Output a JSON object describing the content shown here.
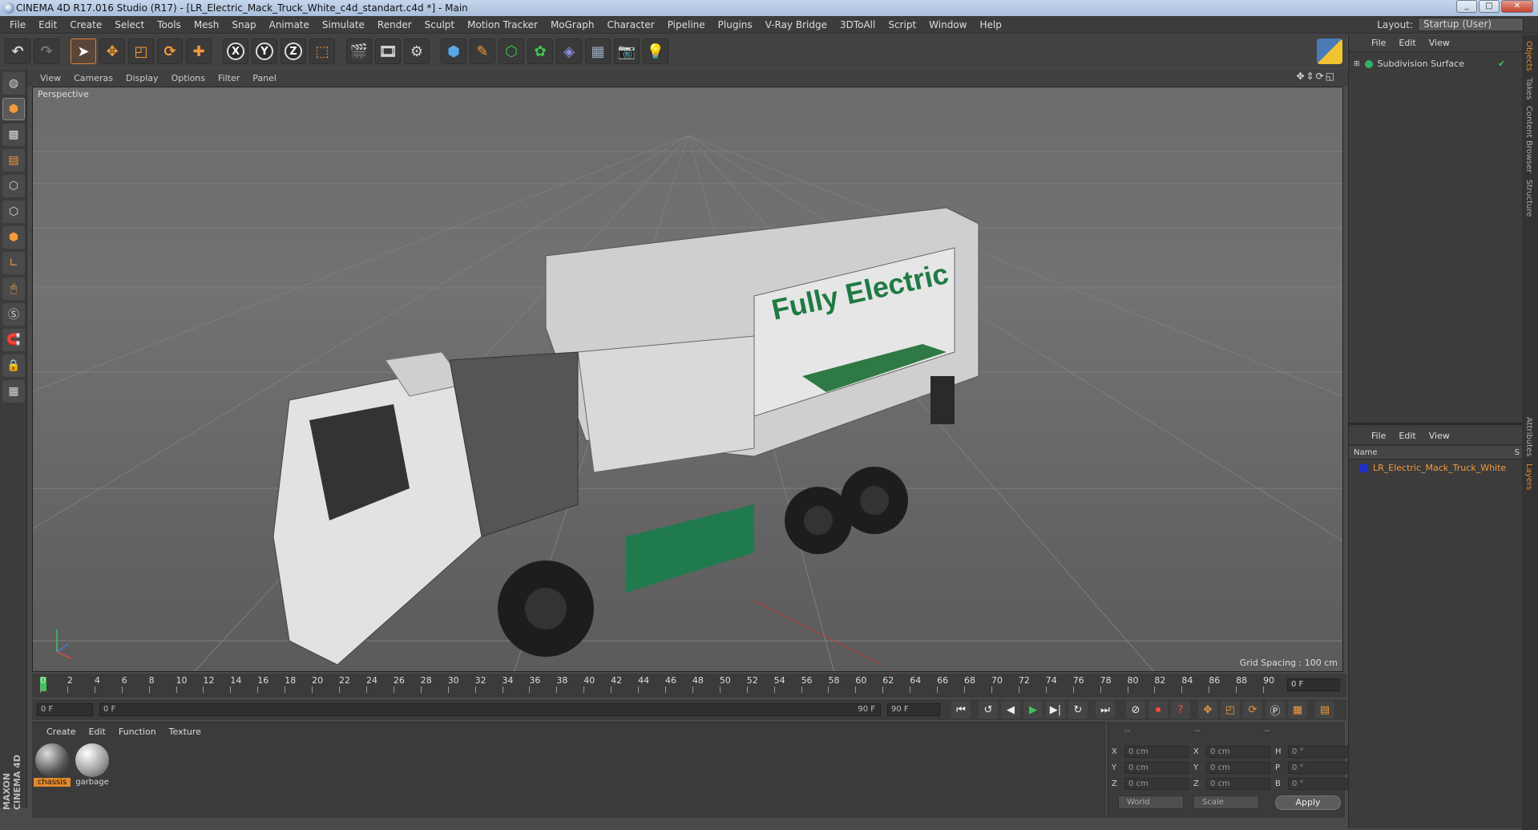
{
  "window": {
    "title": "CINEMA 4D R17.016 Studio (R17) - [LR_Electric_Mack_Truck_White_c4d_standart.c4d *] - Main"
  },
  "menu": [
    "File",
    "Edit",
    "Create",
    "Select",
    "Tools",
    "Mesh",
    "Snap",
    "Animate",
    "Simulate",
    "Render",
    "Sculpt",
    "Motion Tracker",
    "MoGraph",
    "Character",
    "Pipeline",
    "Plugins",
    "V-Ray Bridge",
    "3DToAll",
    "Script",
    "Window",
    "Help"
  ],
  "layout": {
    "label": "Layout:",
    "value": "Startup (User)"
  },
  "axis_buttons": [
    "X",
    "Y",
    "Z"
  ],
  "viewport": {
    "menu": [
      "View",
      "Cameras",
      "Display",
      "Options",
      "Filter",
      "Panel"
    ],
    "label": "Perspective",
    "grid_spacing": "Grid Spacing : 100 cm",
    "decal_text": "Fully Electric"
  },
  "timeline": {
    "ticks": [
      "0",
      "2",
      "4",
      "6",
      "8",
      "10",
      "12",
      "14",
      "16",
      "18",
      "20",
      "22",
      "24",
      "26",
      "28",
      "30",
      "32",
      "34",
      "36",
      "38",
      "40",
      "42",
      "44",
      "46",
      "48",
      "50",
      "52",
      "54",
      "56",
      "58",
      "60",
      "62",
      "64",
      "66",
      "68",
      "70",
      "72",
      "74",
      "76",
      "78",
      "80",
      "82",
      "84",
      "86",
      "88",
      "90"
    ],
    "current_frame": "0 F",
    "start": "0 F",
    "scrub_start": "0 F",
    "scrub_end": "90 F",
    "end": "90 F"
  },
  "materials": {
    "menu": [
      "Create",
      "Edit",
      "Function",
      "Texture"
    ],
    "items": [
      {
        "label": "chassis"
      },
      {
        "label": "garbage"
      }
    ]
  },
  "coordinates": {
    "header": [
      "--",
      "--",
      "--"
    ],
    "rows": [
      {
        "a": "X",
        "av": "0 cm",
        "b": "X",
        "bv": "0 cm",
        "c": "H",
        "cv": "0 °"
      },
      {
        "a": "Y",
        "av": "0 cm",
        "b": "Y",
        "bv": "0 cm",
        "c": "P",
        "cv": "0 °"
      },
      {
        "a": "Z",
        "av": "0 cm",
        "b": "Z",
        "bv": "0 cm",
        "c": "B",
        "cv": "0 °"
      }
    ],
    "mode1": "World",
    "mode2": "Scale",
    "apply": "Apply"
  },
  "objects": {
    "menu": [
      "File",
      "Edit",
      "View"
    ],
    "item": "Subdivision Surface"
  },
  "layers": {
    "menu": [
      "File",
      "Edit",
      "View"
    ],
    "col_name": "Name",
    "col_s": "S",
    "item": "LR_Electric_Mack_Truck_White"
  },
  "side_tabs": [
    "Objects",
    "Takes",
    "Content Browser",
    "Structure",
    "Attributes",
    "Layers"
  ],
  "brand": "MAXON CINEMA 4D"
}
